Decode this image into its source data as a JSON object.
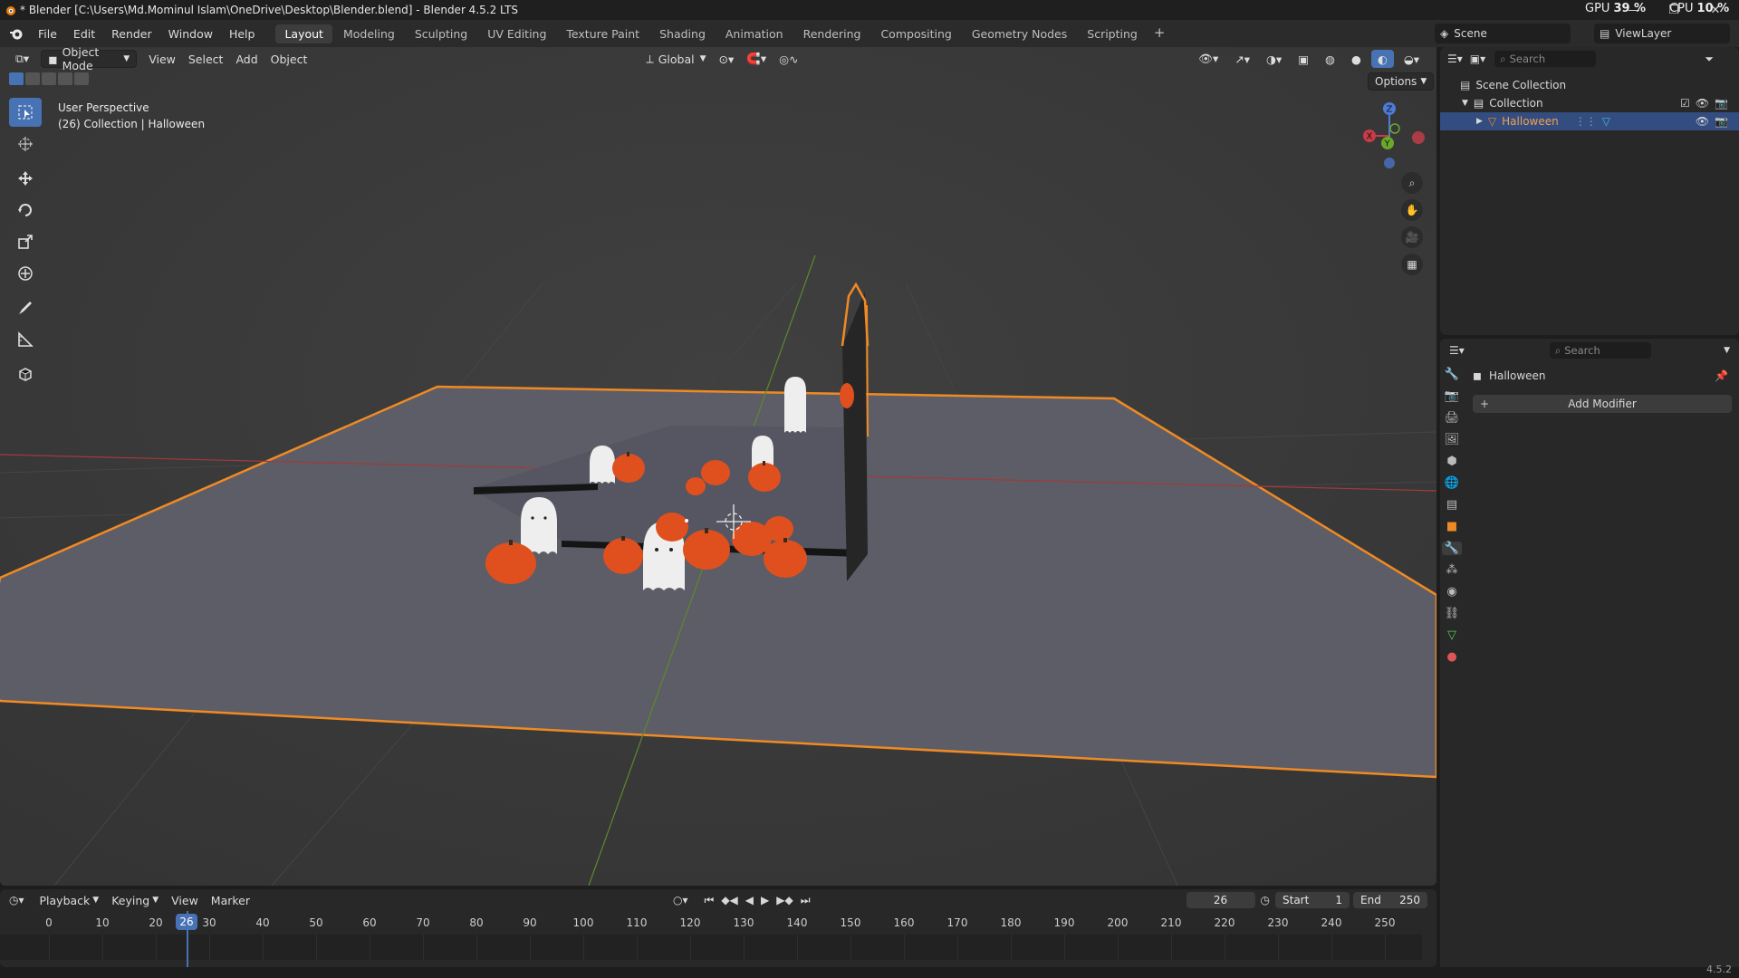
{
  "window": {
    "title": "* Blender [C:\\Users\\Md.Mominul Islam\\OneDrive\\Desktop\\Blender.blend] - Blender 4.5.2 LTS",
    "gpu_label": "GPU",
    "gpu_value": "39 %",
    "cpu_label": "CPU",
    "cpu_value": "10 %"
  },
  "menu": [
    "File",
    "Edit",
    "Render",
    "Window",
    "Help"
  ],
  "workspaces": [
    "Layout",
    "Modeling",
    "Sculpting",
    "UV Editing",
    "Texture Paint",
    "Shading",
    "Animation",
    "Rendering",
    "Compositing",
    "Geometry Nodes",
    "Scripting"
  ],
  "active_workspace": "Layout",
  "scene": {
    "label": "Scene",
    "view_layer": "ViewLayer"
  },
  "viewport_header": {
    "mode": "Object Mode",
    "menus": [
      "View",
      "Select",
      "Add",
      "Object"
    ],
    "orientation": "Global",
    "options": "Options"
  },
  "viewport": {
    "perspective": "User Perspective",
    "context": "(26) Collection | Halloween",
    "gizmo": {
      "x": "X",
      "y": "Y",
      "z": "Z"
    }
  },
  "outliner": {
    "search_placeholder": "Search",
    "scene_collection": "Scene Collection",
    "collection": "Collection",
    "object": "Halloween"
  },
  "properties": {
    "search_placeholder": "Search",
    "object_name": "Halloween",
    "add_modifier": "Add Modifier"
  },
  "timeline": {
    "menus": [
      "Playback",
      "Keying",
      "View",
      "Marker"
    ],
    "current_frame": "26",
    "start_label": "Start",
    "start_value": "1",
    "end_label": "End",
    "end_value": "250",
    "ticks": [
      "0",
      "10",
      "20",
      "30",
      "40",
      "50",
      "60",
      "70",
      "80",
      "90",
      "100",
      "110",
      "120",
      "130",
      "140",
      "150",
      "160",
      "170",
      "180",
      "190",
      "200",
      "210",
      "220",
      "230",
      "240",
      "250"
    ],
    "playhead": "26"
  },
  "status": {
    "version": "4.5.2"
  },
  "colors": {
    "accent": "#4772b3",
    "selection_orange": "#f08a24",
    "pumpkin": "#e0501e",
    "ghost": "#f2f2f2"
  }
}
